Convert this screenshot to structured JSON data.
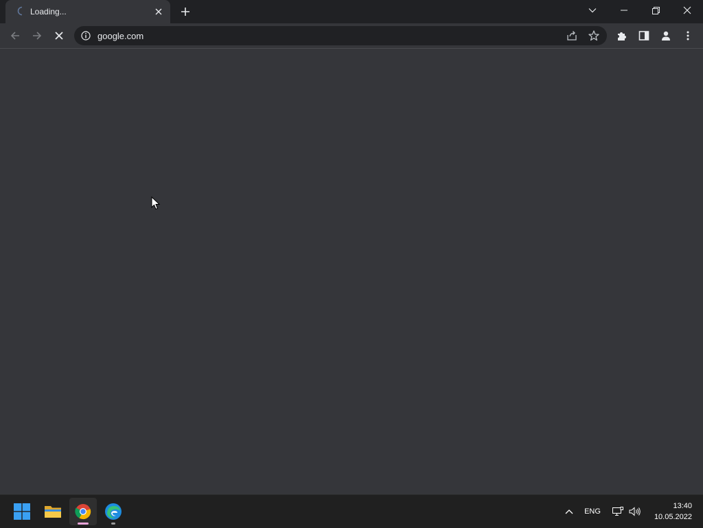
{
  "browser": {
    "tab": {
      "title": "Loading...",
      "close_icon": "close-icon",
      "spinner_icon": "loading-spinner-icon"
    },
    "new_tab_icon": "plus-icon",
    "window_controls": {
      "tab_search_icon": "chevron-down-icon",
      "minimize_icon": "minimize-icon",
      "restore_icon": "restore-icon",
      "close_icon": "close-icon"
    },
    "toolbar": {
      "back_icon": "arrow-left-icon",
      "forward_icon": "arrow-right-icon",
      "stop_icon": "stop-loading-icon",
      "site_info_icon": "info-icon",
      "url": "google.com",
      "share_icon": "share-icon",
      "bookmark_icon": "star-icon",
      "extensions_icon": "puzzle-icon",
      "side_panel_icon": "side-panel-icon",
      "profile_icon": "person-icon",
      "menu_icon": "kebab-menu-icon"
    }
  },
  "taskbar": {
    "apps": [
      {
        "name": "Start",
        "icon": "windows-start-icon",
        "active": false
      },
      {
        "name": "File Explorer",
        "icon": "folder-icon",
        "active": false
      },
      {
        "name": "Google Chrome",
        "icon": "chrome-icon",
        "active": true
      },
      {
        "name": "Microsoft Edge",
        "icon": "edge-icon",
        "active": false
      }
    ],
    "tray": {
      "overflow_icon": "chevron-up-icon",
      "language": "ENG",
      "network_icon": "network-icon",
      "volume_icon": "volume-icon"
    },
    "clock": {
      "time": "13:40",
      "date": "10.05.2022"
    }
  },
  "colors": {
    "titlebar": "#202124",
    "page": "#35363a",
    "omnibox": "#202124",
    "taskbar": "#202020",
    "chrome_indicator": "#e8a4d8"
  }
}
